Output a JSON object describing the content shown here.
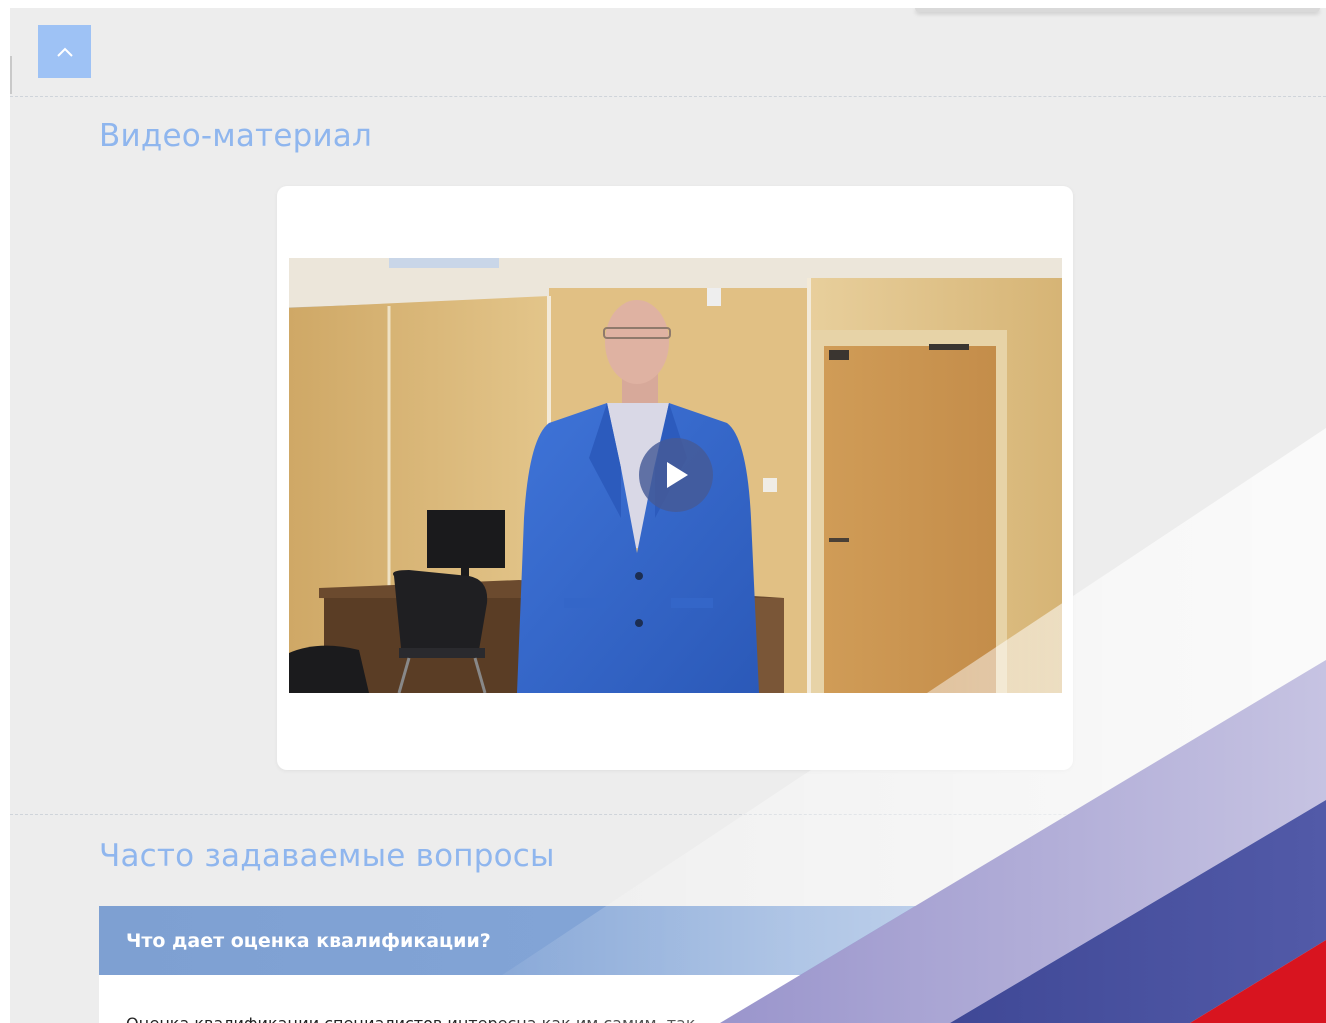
{
  "scroll_top": {
    "icon": "chevron-up-icon"
  },
  "video_section": {
    "title": "Видео-материал",
    "play_icon": "play-icon"
  },
  "faq_section": {
    "title": "Часто задаваемые вопросы",
    "items": [
      {
        "question": "Что дает оценка квалификации?",
        "answer": "Оценка квалификации специалистов интересна как им самим, так"
      }
    ]
  },
  "colors": {
    "accent_blue": "#8fb6ee",
    "button_blue": "#9ec2f5",
    "faq_header": "#7ea0d2",
    "flag_lavender": "#b3aed8",
    "flag_blue": "#4a52a0",
    "flag_red": "#d8141f"
  }
}
